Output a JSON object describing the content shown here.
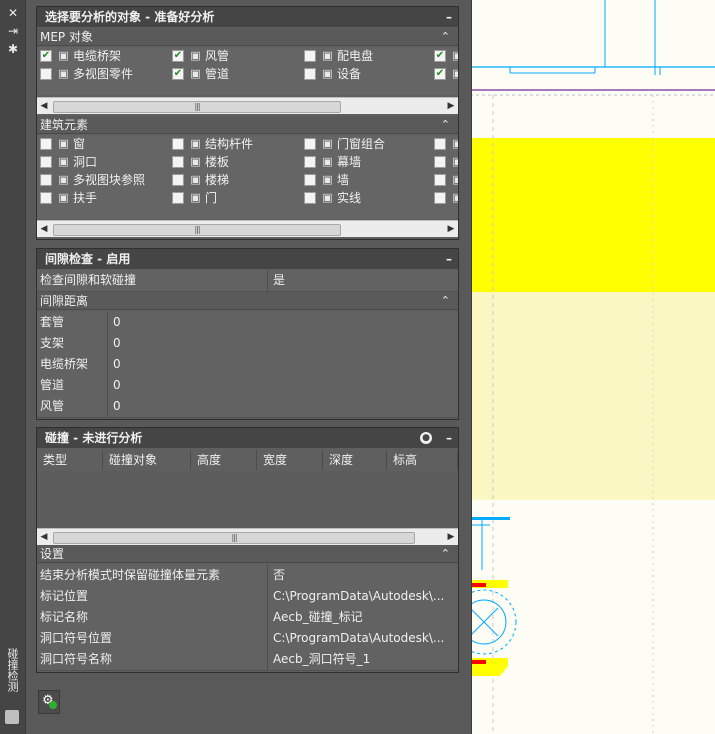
{
  "strip": {
    "close_glyph": "✕",
    "pin_glyph": "⇥",
    "settings_glyph": "✱",
    "vertical_label": "碰撞检测"
  },
  "panel1": {
    "title": "选择要分析的对象 - 准备好分析",
    "collapse_glyph": "–",
    "mep": {
      "header": "MEP 对象",
      "items": [
        {
          "label": "电缆桥架",
          "checked": true,
          "icon": "cable-tray-icon"
        },
        {
          "label": "风管",
          "checked": true,
          "icon": "duct-icon"
        },
        {
          "label": "配电盘",
          "checked": false,
          "icon": "panel-board-icon"
        },
        {
          "label": "",
          "checked": true,
          "icon": "partial-icon"
        },
        {
          "label": "多视图零件",
          "checked": false,
          "icon": "multiview-part-icon"
        },
        {
          "label": "管道",
          "checked": true,
          "icon": "pipe-icon"
        },
        {
          "label": "设备",
          "checked": false,
          "icon": "equipment-icon"
        },
        {
          "label": "",
          "checked": true,
          "icon": "partial-icon"
        }
      ]
    },
    "arch": {
      "header": "建筑元素",
      "items": [
        {
          "label": "窗",
          "checked": false,
          "icon": "window-icon"
        },
        {
          "label": "结构杆件",
          "checked": false,
          "icon": "structural-member-icon"
        },
        {
          "label": "门窗组合",
          "checked": false,
          "icon": "door-window-assembly-icon"
        },
        {
          "label": "",
          "checked": false,
          "icon": "partial-icon"
        },
        {
          "label": "洞口",
          "checked": false,
          "icon": "opening-icon"
        },
        {
          "label": "楼板",
          "checked": false,
          "icon": "slab-icon"
        },
        {
          "label": "幕墙",
          "checked": false,
          "icon": "curtain-wall-icon"
        },
        {
          "label": "",
          "checked": false,
          "icon": "partial-icon"
        },
        {
          "label": "多视图块参照",
          "checked": false,
          "icon": "multiview-block-icon"
        },
        {
          "label": "楼梯",
          "checked": false,
          "icon": "stair-icon"
        },
        {
          "label": "墙",
          "checked": false,
          "icon": "wall-icon"
        },
        {
          "label": "",
          "checked": false,
          "icon": "partial-icon"
        },
        {
          "label": "扶手",
          "checked": false,
          "icon": "railing-icon"
        },
        {
          "label": "门",
          "checked": false,
          "icon": "door-icon"
        },
        {
          "label": "实线",
          "checked": false,
          "icon": "solid-icon"
        },
        {
          "label": "",
          "checked": false,
          "icon": "partial-icon"
        }
      ]
    },
    "scroll_left": "◀",
    "scroll_right": "▶",
    "scroll_thumb": "|||"
  },
  "panel2": {
    "title": "间隙检查 - 启用",
    "collapse_glyph": "–",
    "check_label": "检查间隙和软碰撞",
    "check_value": "是",
    "distance_header": "间隙距离",
    "rows": [
      {
        "key": "套管",
        "value": "0"
      },
      {
        "key": "支架",
        "value": "0"
      },
      {
        "key": "电缆桥架",
        "value": "0"
      },
      {
        "key": "管道",
        "value": "0"
      },
      {
        "key": "风管",
        "value": "0"
      }
    ]
  },
  "panel3": {
    "title": "碰撞 - 未进行分析",
    "collapse_glyph": "–",
    "columns": [
      "类型",
      "碰撞对象",
      "高度",
      "宽度",
      "深度",
      "标高"
    ],
    "settings_header": "设置",
    "settings": [
      {
        "key": "结束分析模式时保留碰撞体量元素",
        "value": "否"
      },
      {
        "key": "标记位置",
        "value": "C:\\ProgramData\\Autodesk\\..."
      },
      {
        "key": "标记名称",
        "value": "Aecb_碰撞_标记"
      },
      {
        "key": "洞口符号位置",
        "value": "C:\\ProgramData\\Autodesk\\..."
      },
      {
        "key": "洞口符号名称",
        "value": "Aecb_洞口符号_1"
      }
    ]
  },
  "chevron_up": "⌃",
  "check_glyph": "✔",
  "colors": {
    "yellow": "#ffff00",
    "pale_yellow": "#fbf7c2",
    "cyan": "#00aaff",
    "purple": "#7a2a9a",
    "red": "#ff0000"
  }
}
